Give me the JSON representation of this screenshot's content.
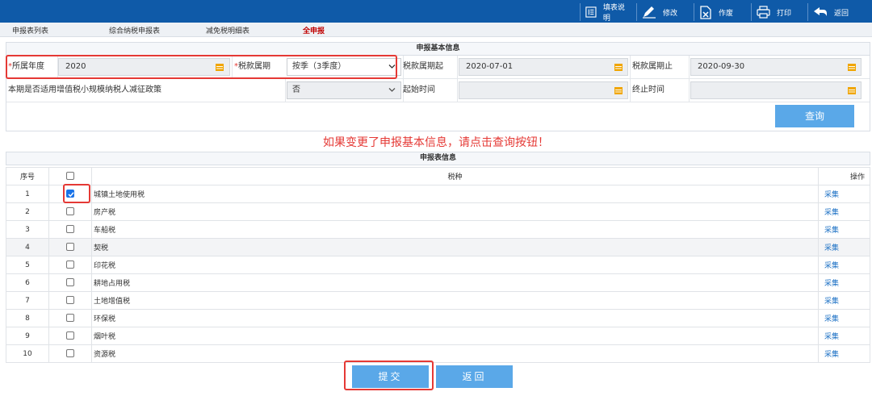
{
  "toolbar": {
    "buttons": [
      {
        "label": "填表说明",
        "icon": "form-guide-icon"
      },
      {
        "label": "修改",
        "icon": "pencil-icon"
      },
      {
        "label": "作废",
        "icon": "void-document-icon"
      },
      {
        "label": "打印",
        "icon": "printer-icon"
      },
      {
        "label": "返回",
        "icon": "back-arrow-icon"
      }
    ]
  },
  "tabs": [
    "申报表列表",
    "综合纳税申报表",
    "减免税明细表",
    "全申报"
  ],
  "basic_info": {
    "title": "申报基本信息",
    "year_label": "所属年度",
    "year_value": "2020",
    "period_type_label": "税款属期",
    "period_type_value": "按季（3季度）",
    "period_start_label": "税款属期起",
    "period_start_value": "2020-07-01",
    "period_end_label": "税款属期止",
    "period_end_value": "2020-09-30",
    "policy_label": "本期是否适用增值税小规模纳税人减征政策",
    "policy_value": "否",
    "start_time_label": "起始时间",
    "start_time_value": "",
    "end_time_label": "终止时间",
    "end_time_value": "",
    "query_label": "查询"
  },
  "notice": "如果变更了申报基本信息，请点击查询按钮！",
  "table": {
    "title": "申报表信息",
    "headers": {
      "no": "序号",
      "tax": "税种",
      "op": "操作"
    },
    "rows": [
      {
        "no": "1",
        "tax": "城镇土地使用税",
        "checked": true,
        "op": "采集"
      },
      {
        "no": "2",
        "tax": "房产税",
        "checked": false,
        "op": "采集"
      },
      {
        "no": "3",
        "tax": "车船税",
        "checked": false,
        "op": "采集"
      },
      {
        "no": "4",
        "tax": "契税",
        "checked": false,
        "op": "采集"
      },
      {
        "no": "5",
        "tax": "印花税",
        "checked": false,
        "op": "采集"
      },
      {
        "no": "6",
        "tax": "耕地占用税",
        "checked": false,
        "op": "采集"
      },
      {
        "no": "7",
        "tax": "土地增值税",
        "checked": false,
        "op": "采集"
      },
      {
        "no": "8",
        "tax": "环保税",
        "checked": false,
        "op": "采集"
      },
      {
        "no": "9",
        "tax": "烟叶税",
        "checked": false,
        "op": "采集"
      },
      {
        "no": "10",
        "tax": "资源税",
        "checked": false,
        "op": "采集"
      }
    ]
  },
  "footer": {
    "submit_label": "提交",
    "back_label": "返回"
  },
  "colors": {
    "accent": "#0f5aa8",
    "button": "#5aa8e8",
    "warning": "#e53935",
    "link": "#1a6fc4"
  }
}
